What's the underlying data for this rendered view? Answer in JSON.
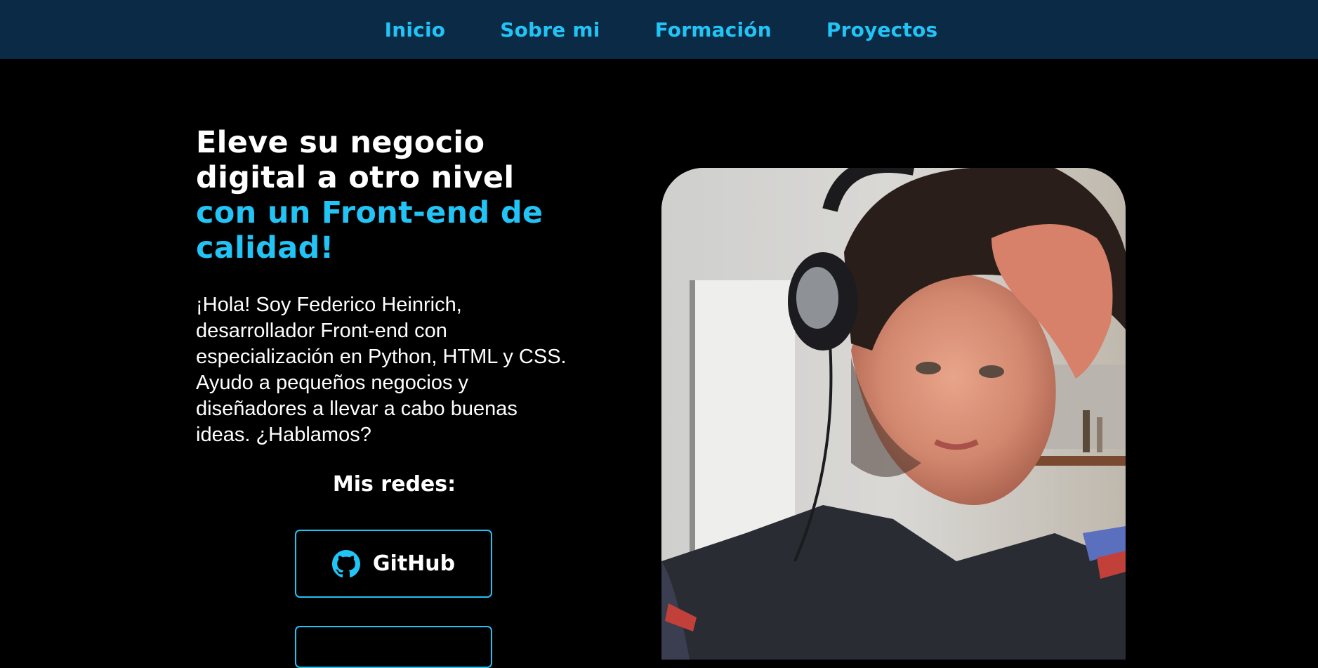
{
  "nav": {
    "items": [
      {
        "label": "Inicio"
      },
      {
        "label": "Sobre mi"
      },
      {
        "label": "Formación"
      },
      {
        "label": "Proyectos"
      }
    ]
  },
  "hero": {
    "headline_white_1": "Eleve su negocio",
    "headline_white_2": "digital a otro nivel",
    "headline_accent_1": "con un Front-end de",
    "headline_accent_2": "calidad!",
    "intro": "¡Hola! Soy Federico Heinrich, desarrollador Front-end con especialización en Python, HTML y CSS. Ayudo a pequeños negocios y diseñadores a llevar a cabo buenas ideas. ¿Hablamos?",
    "social_title": "Mis redes:",
    "social_buttons": [
      {
        "label": "GitHub",
        "icon": "github-icon"
      },
      {
        "label": "",
        "icon": ""
      }
    ]
  },
  "colors": {
    "nav_bg": "#0b2a45",
    "accent": "#22c3f5",
    "page_bg": "#000000",
    "text": "#ffffff"
  }
}
